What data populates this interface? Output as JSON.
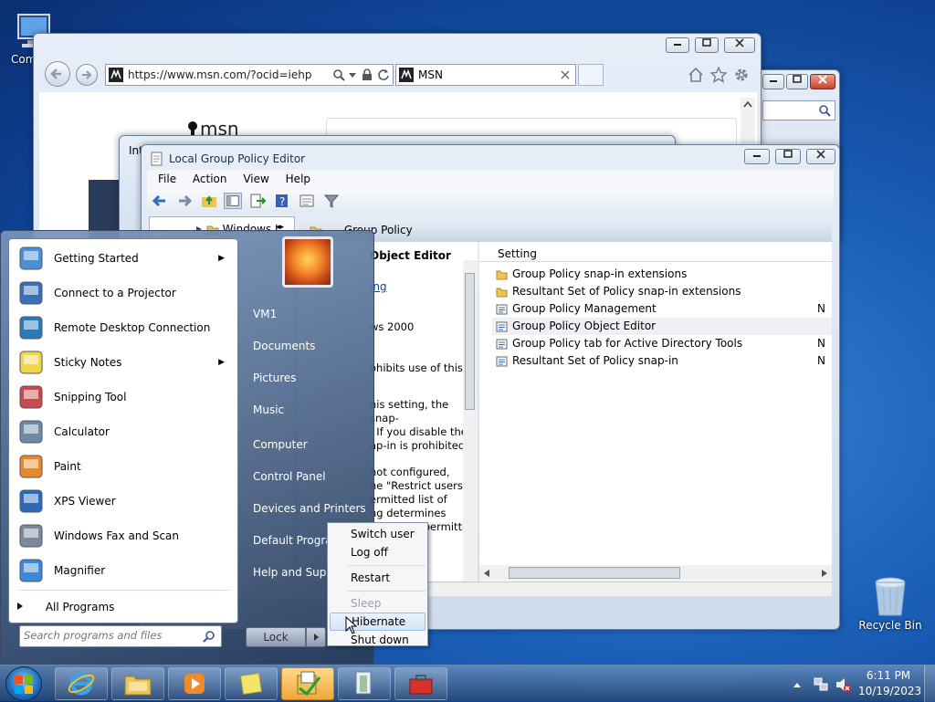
{
  "desktop": {
    "computer_label": "Com",
    "recycle_label": "Recycle Bin"
  },
  "ie": {
    "url": "https://www.msn.com/?ocid=iehp",
    "tab_title": "MSN",
    "logo_text": "msn"
  },
  "back_window_title": "Int",
  "gpe": {
    "title": "Local Group Policy Editor",
    "menu": [
      "File",
      "Action",
      "View",
      "Help"
    ],
    "tree_node": "Windows I",
    "header_folder": "Group Policy",
    "detail_title": "Object Editor",
    "detail_link": "ing",
    "detail_lines": [
      "ws 2000",
      "ohibits use of this",
      "his setting, the snap-",
      ". If you disable the",
      "ap-in is prohibited.",
      "not configured,",
      "he \"Restrict users to",
      "ermitted list of",
      "ng determines",
      "snap-in is permitted",
      "snap-"
    ],
    "column_setting": "Setting",
    "items": [
      {
        "label": "Group Policy snap-in extensions",
        "type": "folder",
        "state": ""
      },
      {
        "label": "Resultant Set of Policy snap-in extensions",
        "type": "folder",
        "state": ""
      },
      {
        "label": "Group Policy Management",
        "type": "policy",
        "state": "N"
      },
      {
        "label": "Group Policy Object Editor",
        "type": "policy",
        "state": ""
      },
      {
        "label": "Group Policy tab for Active Directory Tools",
        "type": "policy",
        "state": "N"
      },
      {
        "label": "Resultant Set of Policy snap-in",
        "type": "policy",
        "state": "N"
      }
    ]
  },
  "start_menu": {
    "left_items": [
      {
        "label": "Getting Started",
        "arrow": "▶"
      },
      {
        "label": "Connect to a Projector",
        "arrow": ""
      },
      {
        "label": "Remote Desktop Connection",
        "arrow": ""
      },
      {
        "label": "Sticky Notes",
        "arrow": "▶"
      },
      {
        "label": "Snipping Tool",
        "arrow": ""
      },
      {
        "label": "Calculator",
        "arrow": ""
      },
      {
        "label": "Paint",
        "arrow": ""
      },
      {
        "label": "XPS Viewer",
        "arrow": ""
      },
      {
        "label": "Windows Fax and Scan",
        "arrow": ""
      },
      {
        "label": "Magnifier",
        "arrow": ""
      }
    ],
    "all_programs": "All Programs",
    "search_placeholder": "Search programs and files",
    "right_items": [
      "VM1",
      "Documents",
      "Pictures",
      "Music",
      "Computer",
      "Control Panel",
      "Devices and Printers",
      "Default Programs",
      "Help and Support"
    ],
    "lock_label": "Lock"
  },
  "power_menu": {
    "items": [
      "Switch user",
      "Log off",
      "Restart",
      "Sleep",
      "Hibernate",
      "Shut down"
    ]
  },
  "taskbar": {
    "time": "6:11 PM",
    "date": "10/19/2023"
  }
}
